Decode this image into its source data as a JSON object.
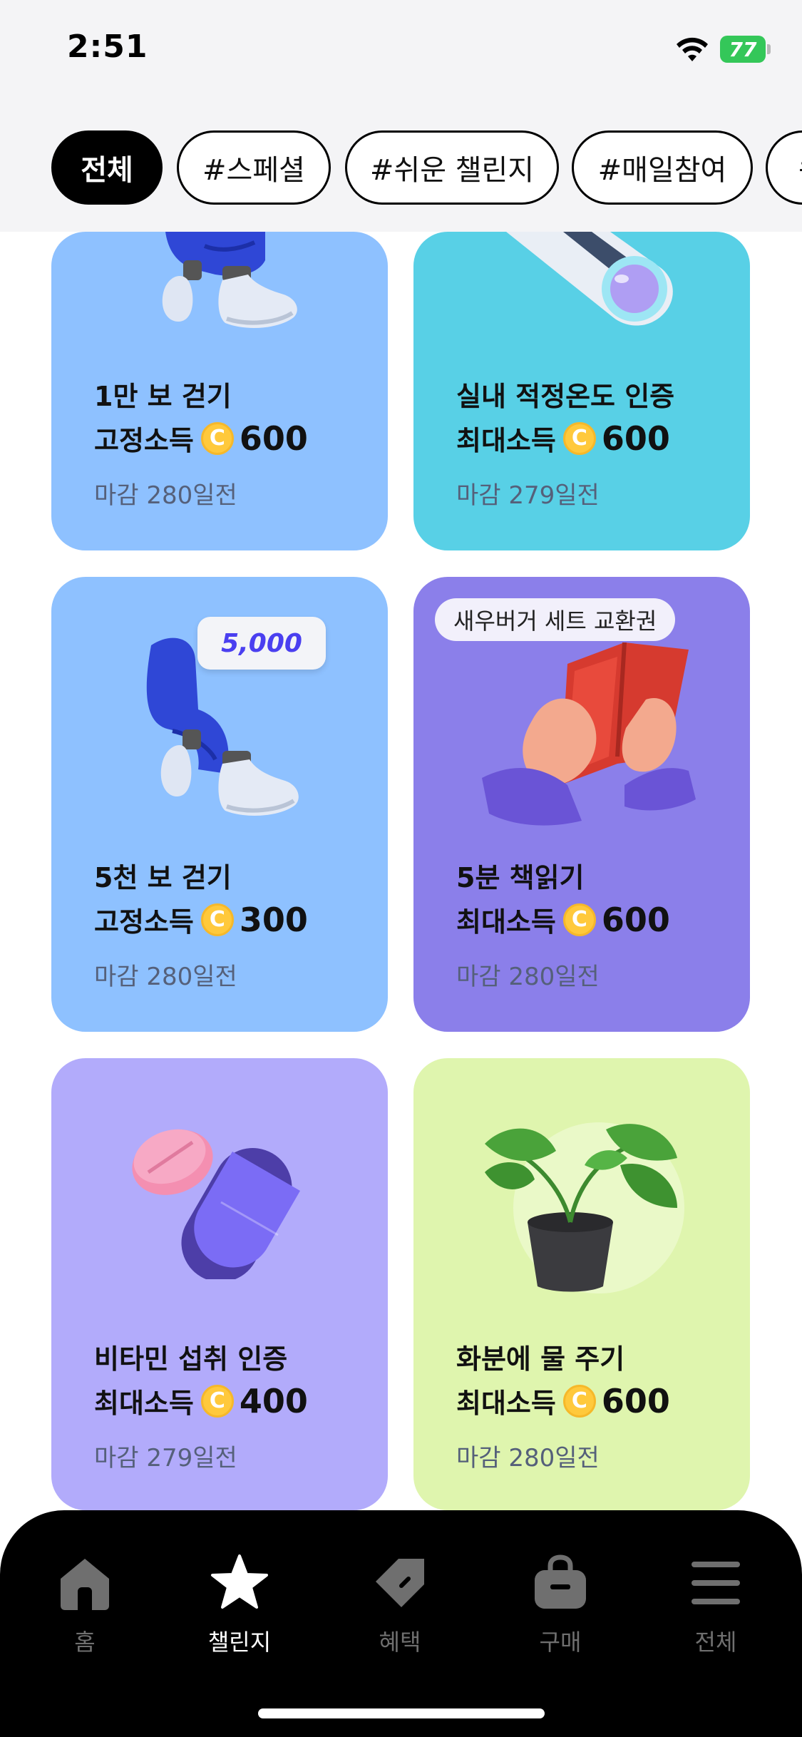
{
  "status_bar": {
    "time": "2:51",
    "battery": "77"
  },
  "filters": {
    "chips": [
      "전체",
      "#스페셜",
      "#쉬운 챌린지",
      "#매일참여",
      "#"
    ],
    "active_index": 0
  },
  "cards": [
    {
      "title": "1만 보 걷기",
      "reward_label": "고정소득",
      "coin": "C",
      "amount": "600",
      "deadline": "마감 280일전",
      "bg": "#8ec1ff",
      "illustration": "walking-sneakers"
    },
    {
      "title": "실내 적정온도 인증",
      "reward_label": "최대소득",
      "coin": "C",
      "amount": "600",
      "deadline": "마감 279일전",
      "bg": "#58d0e6",
      "illustration": "thermometer"
    },
    {
      "title": "5천 보 걷기",
      "reward_label": "고정소득",
      "coin": "C",
      "amount": "300",
      "deadline": "마감 280일전",
      "bg": "#8ec1ff",
      "illustration": "walking-legs",
      "bubble": "5,000"
    },
    {
      "title": "5분 책읽기",
      "reward_label": "최대소득",
      "coin": "C",
      "amount": "600",
      "deadline": "마감 280일전",
      "bg": "#8b7fea",
      "illustration": "hands-book",
      "badge": "새우버거 세트 교환권"
    },
    {
      "title": "비타민 섭취 인증",
      "reward_label": "최대소득",
      "coin": "C",
      "amount": "400",
      "deadline": "마감 279일전",
      "bg": "#b2abfb",
      "illustration": "pills"
    },
    {
      "title": "화분에 물 주기",
      "reward_label": "최대소득",
      "coin": "C",
      "amount": "600",
      "deadline": "마감 280일전",
      "bg": "#dff5ae",
      "illustration": "potted-plant"
    }
  ],
  "bottom_nav": {
    "items": [
      {
        "label": "홈",
        "icon": "home-icon"
      },
      {
        "label": "챌린지",
        "icon": "star-icon"
      },
      {
        "label": "혜택",
        "icon": "tag-icon"
      },
      {
        "label": "구매",
        "icon": "bag-icon"
      },
      {
        "label": "전체",
        "icon": "menu-icon"
      }
    ],
    "active_index": 1
  },
  "colors": {
    "active_chip": "#000000",
    "nav_bg": "#000000",
    "coin": "#ffc93c",
    "deadline": "#55607a"
  }
}
